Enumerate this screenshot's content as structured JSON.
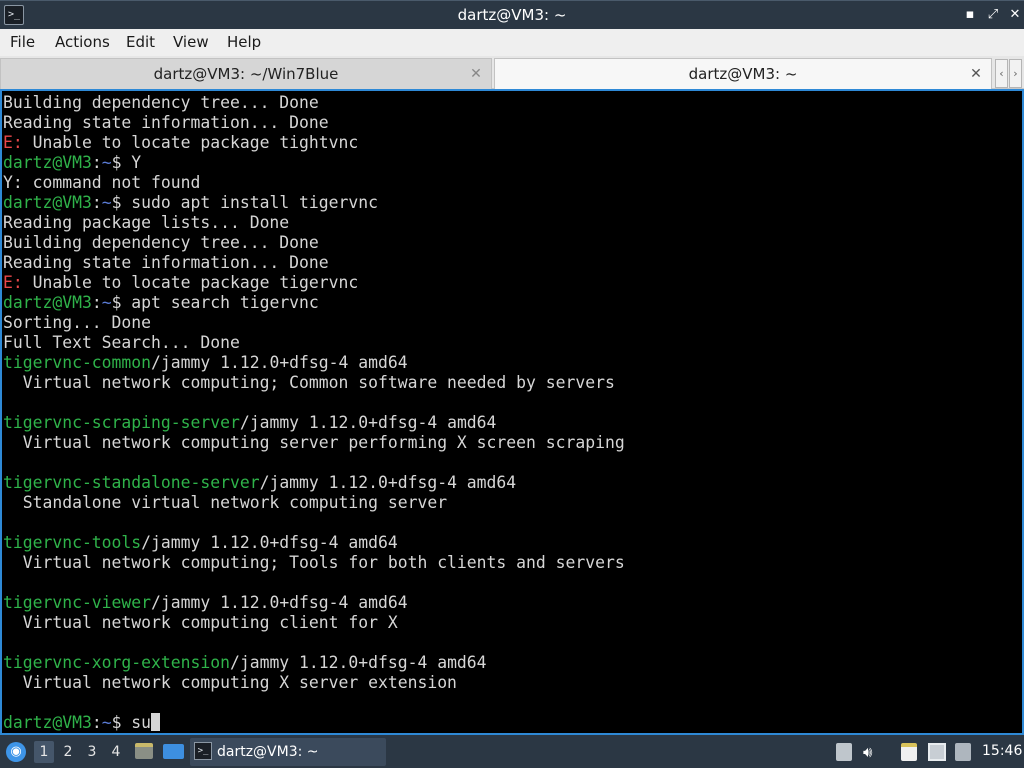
{
  "window": {
    "title": "dartz@VM3: ~",
    "icon": "terminal-icon",
    "controls": {
      "minimize": "▪",
      "maximize": "⤢",
      "close": "✕"
    }
  },
  "menu": [
    "File",
    "Actions",
    "Edit",
    "View",
    "Help"
  ],
  "tabs": [
    {
      "label": "dartz@VM3: ~/Win7Blue",
      "close": "✕",
      "active": false
    },
    {
      "label": "dartz@VM3: ~",
      "close": "✕",
      "active": true
    }
  ],
  "tab_scroll": {
    "left": "‹",
    "right": "›"
  },
  "terminal": {
    "colors": {
      "prompt": "#2fb34a",
      "path": "#5b7cd6",
      "error": "#e8474a",
      "text": "#d6d6d6",
      "border": "#2e89d6"
    },
    "lines": [
      [
        {
          "t": "Building dependency tree... Done",
          "c": "normal"
        }
      ],
      [
        {
          "t": "Reading state information... Done",
          "c": "normal"
        }
      ],
      [
        {
          "t": "E:",
          "c": "red"
        },
        {
          "t": " Unable to locate package tightvnc",
          "c": "normal"
        }
      ],
      [
        {
          "t": "dartz@VM3",
          "c": "green"
        },
        {
          "t": ":",
          "c": "normal"
        },
        {
          "t": "~",
          "c": "blue"
        },
        {
          "t": "$ Y",
          "c": "normal"
        }
      ],
      [
        {
          "t": "Y: command not found",
          "c": "normal"
        }
      ],
      [
        {
          "t": "dartz@VM3",
          "c": "green"
        },
        {
          "t": ":",
          "c": "normal"
        },
        {
          "t": "~",
          "c": "blue"
        },
        {
          "t": "$ sudo apt install tigervnc",
          "c": "normal"
        }
      ],
      [
        {
          "t": "Reading package lists... Done",
          "c": "normal"
        }
      ],
      [
        {
          "t": "Building dependency tree... Done",
          "c": "normal"
        }
      ],
      [
        {
          "t": "Reading state information... Done",
          "c": "normal"
        }
      ],
      [
        {
          "t": "E:",
          "c": "red"
        },
        {
          "t": " Unable to locate package tigervnc",
          "c": "normal"
        }
      ],
      [
        {
          "t": "dartz@VM3",
          "c": "green"
        },
        {
          "t": ":",
          "c": "normal"
        },
        {
          "t": "~",
          "c": "blue"
        },
        {
          "t": "$ apt search tigervnc",
          "c": "normal"
        }
      ],
      [
        {
          "t": "Sorting... Done",
          "c": "normal"
        }
      ],
      [
        {
          "t": "Full Text Search... Done",
          "c": "normal"
        }
      ],
      [
        {
          "t": "tigervnc-common",
          "c": "green"
        },
        {
          "t": "/jammy 1.12.0+dfsg-4 amd64",
          "c": "normal"
        }
      ],
      [
        {
          "t": "  Virtual network computing; Common software needed by servers",
          "c": "normal"
        }
      ],
      [
        {
          "t": "",
          "c": "normal"
        }
      ],
      [
        {
          "t": "tigervnc-scraping-server",
          "c": "green"
        },
        {
          "t": "/jammy 1.12.0+dfsg-4 amd64",
          "c": "normal"
        }
      ],
      [
        {
          "t": "  Virtual network computing server performing X screen scraping",
          "c": "normal"
        }
      ],
      [
        {
          "t": "",
          "c": "normal"
        }
      ],
      [
        {
          "t": "tigervnc-standalone-server",
          "c": "green"
        },
        {
          "t": "/jammy 1.12.0+dfsg-4 amd64",
          "c": "normal"
        }
      ],
      [
        {
          "t": "  Standalone virtual network computing server",
          "c": "normal"
        }
      ],
      [
        {
          "t": "",
          "c": "normal"
        }
      ],
      [
        {
          "t": "tigervnc-tools",
          "c": "green"
        },
        {
          "t": "/jammy 1.12.0+dfsg-4 amd64",
          "c": "normal"
        }
      ],
      [
        {
          "t": "  Virtual network computing; Tools for both clients and servers",
          "c": "normal"
        }
      ],
      [
        {
          "t": "",
          "c": "normal"
        }
      ],
      [
        {
          "t": "tigervnc-viewer",
          "c": "green"
        },
        {
          "t": "/jammy 1.12.0+dfsg-4 amd64",
          "c": "normal"
        }
      ],
      [
        {
          "t": "  Virtual network computing client for X",
          "c": "normal"
        }
      ],
      [
        {
          "t": "",
          "c": "normal"
        }
      ],
      [
        {
          "t": "tigervnc-xorg-extension",
          "c": "green"
        },
        {
          "t": "/jammy 1.12.0+dfsg-4 amd64",
          "c": "normal"
        }
      ],
      [
        {
          "t": "  Virtual network computing X server extension",
          "c": "normal"
        }
      ],
      [
        {
          "t": "",
          "c": "normal"
        }
      ],
      [
        {
          "t": "dartz@VM3",
          "c": "green"
        },
        {
          "t": ":",
          "c": "normal"
        },
        {
          "t": "~",
          "c": "blue"
        },
        {
          "t": "$ su",
          "c": "normal"
        }
      ]
    ]
  },
  "taskbar": {
    "start_icon": "lubuntu-start-icon",
    "workspaces": [
      "1",
      "2",
      "3",
      "4"
    ],
    "active_workspace": "1",
    "launchers": [
      "file-manager-icon",
      "show-desktop-icon"
    ],
    "tasks": [
      {
        "label": "dartz@VM3: ~",
        "icon": "terminal-icon"
      }
    ],
    "tray": [
      "cursor-icon",
      "volume-icon",
      "clipboard-icon",
      "notes-icon",
      "network-icon",
      "update-notifier-icon"
    ],
    "clock": "15:46"
  }
}
